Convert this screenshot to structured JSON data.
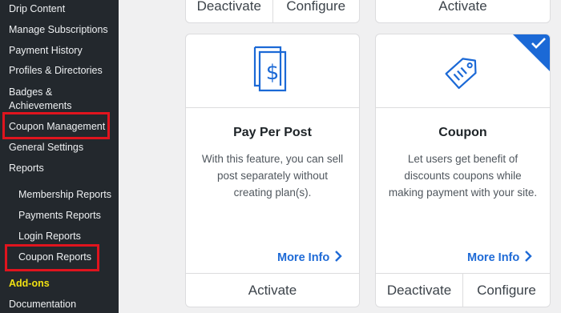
{
  "sidebar": {
    "items": [
      {
        "label": "Drip Content"
      },
      {
        "label": "Manage Subscriptions"
      },
      {
        "label": "Payment History"
      },
      {
        "label": "Profiles & Directories"
      },
      {
        "label": "Badges &"
      },
      {
        "label": "Achievements"
      },
      {
        "label": "Coupon Management"
      },
      {
        "label": "General Settings"
      },
      {
        "label": "Reports"
      },
      {
        "label": "Membership Reports"
      },
      {
        "label": "Payments Reports"
      },
      {
        "label": "Login Reports"
      },
      {
        "label": "Coupon Reports"
      },
      {
        "label": "Add-ons"
      },
      {
        "label": "Documentation"
      }
    ],
    "colors": {
      "background": "#23282d",
      "text": "#eef0f2",
      "active": "#f0e012",
      "highlight": "#e0141e"
    }
  },
  "cards": {
    "top_left": {
      "buttons": [
        "Deactivate",
        "Configure"
      ]
    },
    "top_right": {
      "buttons": [
        "Activate"
      ]
    },
    "pay_per_post": {
      "icon": "dollar-document-icon",
      "title": "Pay Per Post",
      "desc_lines": [
        "With this feature, you can sell",
        "post separately without",
        "creating plan(s)."
      ],
      "more_info": "More Info",
      "buttons": [
        "Activate"
      ]
    },
    "coupon": {
      "icon": "coupon-tag-icon",
      "active_badge": "checkmark-icon",
      "title": "Coupon",
      "desc_lines": [
        "Let users get benefit of",
        "discounts coupons while",
        "making payment with your site."
      ],
      "more_info": "More Info",
      "buttons": [
        "Deactivate",
        "Configure"
      ]
    }
  },
  "colors": {
    "accent": "#1e6ad6"
  }
}
